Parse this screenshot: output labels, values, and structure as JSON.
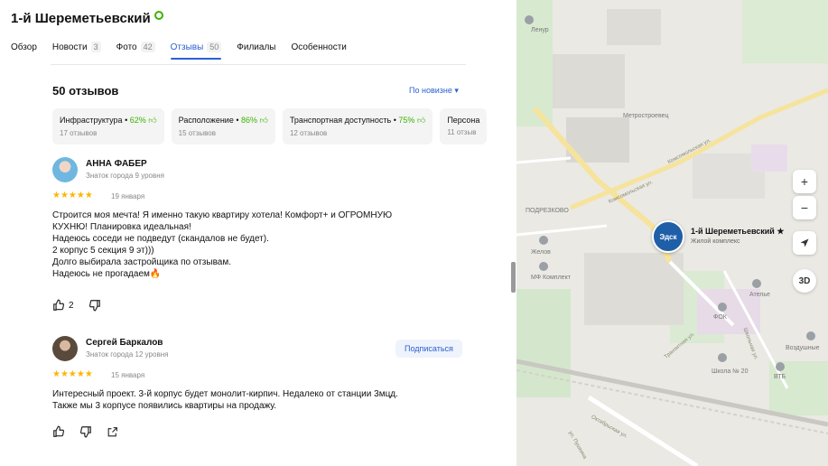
{
  "org": {
    "title": "1-й Шереметьевский"
  },
  "tabs": [
    {
      "label": "Обзор",
      "count": ""
    },
    {
      "label": "Новости",
      "count": "3"
    },
    {
      "label": "Фото",
      "count": "42"
    },
    {
      "label": "Отзывы",
      "count": "50"
    },
    {
      "label": "Филиалы",
      "count": ""
    },
    {
      "label": "Особенности",
      "count": ""
    }
  ],
  "reviews_header": {
    "title": "50 отзывов",
    "sort_label": "По новизне ▾"
  },
  "aspects": [
    {
      "name": "Инфраструктура",
      "pct": "62%",
      "count": "17 отзывов"
    },
    {
      "name": "Расположение",
      "pct": "86%",
      "count": "15 отзывов"
    },
    {
      "name": "Транспортная доступность",
      "pct": "75%",
      "count": "12 отзывов"
    },
    {
      "name": "Персона",
      "pct": "",
      "count": "11 отзыв"
    }
  ],
  "reviews": [
    {
      "author": "АННА ФАБЕР",
      "level": "Знаток города 9 уровня",
      "stars": "★★★★★",
      "date": "19 января",
      "text": "Строится моя мечта! Я именно такую квартиру хотела! Комфорт+ и ОГРОМНУЮ\nКУХНЮ! Планировка идеальная!\nНадеюсь соседи не подведут (скандалов не будет).\n2 корпус 5 секция 9 эт)))\nДолго выбирала застройщика по отзывам.\nНадеюсь не прогадаем🔥",
      "likes": "2"
    },
    {
      "author": "Сергей Баркалов",
      "level": "Знаток города 12 уровня",
      "stars": "★★★★★",
      "date": "15 января",
      "text": "Интересный проект. 3-й корпус будет монолит-кирпич. Недалеко от станции 3мцд.\nТакже мы 3 корпусе появились квартиры на продажу.",
      "subscribe": "Подписаться"
    }
  ],
  "map": {
    "labels": {
      "lenur": "Ленур",
      "metrostroevets": "Метростроевец",
      "podrezkovo": "ПОДРЕЗКОВО",
      "zhelov": "Желов",
      "mf": "МФ Комплект",
      "atele": "Ателье",
      "fok": "ФОК",
      "vozdushnye": "Воздушные",
      "school": "Школа № 20",
      "vtb": "ВТБ",
      "komsomolskaya": "Комсомольская ул.",
      "komsomolskaya2": "Комсомольская ул.",
      "tranzitnaya": "Транзитная ул.",
      "oktyabrskaya": "Октябрьская ул.",
      "shkolnaya": "Школьная ул.",
      "pushkina": "ул. Пушкина"
    },
    "pin": {
      "logo": "Эдск",
      "title": "1-й Шереметьевский ★",
      "subtitle": "Жилой комплекс"
    },
    "controls": {
      "zoom_in": "+",
      "zoom_out": "−",
      "mode_3d": "3D"
    }
  }
}
